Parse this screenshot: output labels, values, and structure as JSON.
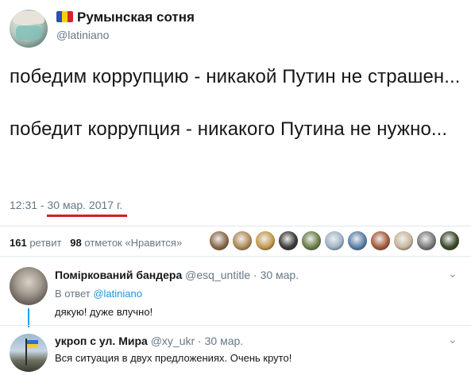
{
  "header": {
    "name": "Румынская сотня",
    "handle": "@latiniano",
    "flag_colors": [
      "#2b4fb3",
      "#f5d300",
      "#d8232a"
    ]
  },
  "tweet": {
    "text": "победим коррупцию - никакой Путин не страшен...\n\nпобедит коррупция - никакого Путина не нужно...",
    "time": "12:31",
    "separator": " - ",
    "date": "30 мар. 2017 г."
  },
  "stats": {
    "retweets_count": "161",
    "retweets_label": "ретвит",
    "likes_count": "98",
    "likes_label": "отметок «Нравится»"
  },
  "likers": [
    "#8b6a4a",
    "#b08b5a",
    "#c59a4c",
    "#3a3a3a",
    "#6b7f4a",
    "#9fb4c8",
    "#5a7fa8",
    "#a85a3a",
    "#c9b79a",
    "#7a7a7a",
    "#3a4a2a"
  ],
  "replies": [
    {
      "name": "Поміркований бандера",
      "handle": "@esq_untitle",
      "time": "30 мар.",
      "reply_prefix": "В ответ",
      "reply_to": "@latiniano",
      "text": "дякую! дуже влучно!"
    },
    {
      "name": "укроп с ул. Мира",
      "handle": "@xy_ukr",
      "time": "30 мар.",
      "text": "Вся ситуация в двух предложениях. Очень круто!"
    }
  ],
  "icons": {
    "chevron": "⌄"
  },
  "accent": "#1da1f2",
  "underline_color": "#d0202a"
}
